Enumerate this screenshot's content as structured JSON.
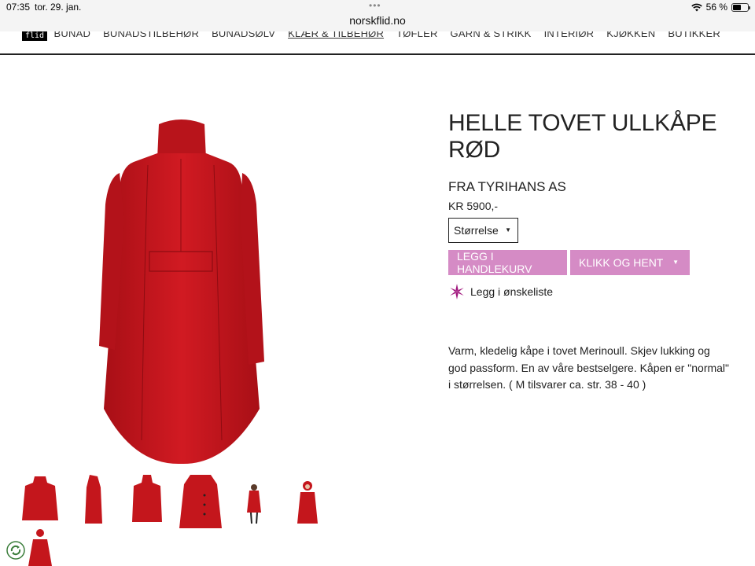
{
  "status_bar": {
    "time": "07:35",
    "date": "tor. 29. jan.",
    "url": "norskflid.no",
    "battery": "56 %",
    "battery_level": 0.56
  },
  "header": {
    "logo": "flid",
    "nav": [
      "BUNAD",
      "BUNADSTILBEHØR",
      "BUNADSØLV",
      "KLÆR & TILBEHØR",
      "TØFLER",
      "GARN & STRIKK",
      "INTERIØR",
      "KJØKKEN",
      "BUTIKKER"
    ],
    "active_nav": "KLÆR & TILBEHØR"
  },
  "product": {
    "title": "HELLE TOVET ULLKÅPE RØD",
    "brand": "FRA TYRIHANS AS",
    "price": "KR 5900,-",
    "size_select_label": "Størrelse",
    "add_to_cart": "LEGG I HANDLEKURV",
    "click_collect": "KLIKK OG HENT",
    "wishlist": "Legg i ønskeliste",
    "description": "Varm, kledelig kåpe i tovet Merinoull. Skjev lukking og god passform. En av våre bestselgere. Kåpen er \"normal\" i størrelsen. ( M tilsvarer ca. str. 38 - 40 )"
  },
  "thumbnails": [
    "coat-front",
    "coat-side",
    "coat-back",
    "coat-detail",
    "model-full",
    "model-hood",
    "model-partial"
  ],
  "colors": {
    "accent": "#d58bc5",
    "coat_red": "#c4161c",
    "star": "#a0157d"
  }
}
